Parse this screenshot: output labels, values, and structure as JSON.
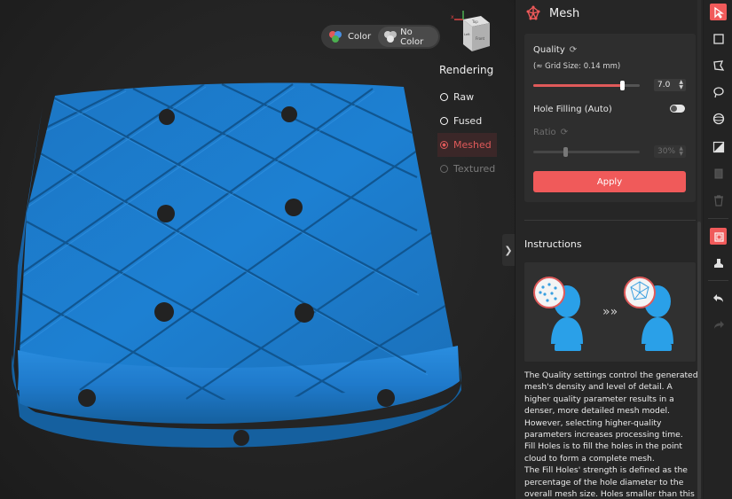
{
  "viewport": {
    "color_toggle": {
      "color_label": "Color",
      "nocolor_label": "No Color"
    },
    "view_cube": {
      "top_face_label": "Top",
      "front_face_label": "Front",
      "side_face_label": "Left"
    },
    "rendering": {
      "title": "Rendering",
      "options": [
        {
          "label": "Raw",
          "state": "normal"
        },
        {
          "label": "Fused",
          "state": "normal"
        },
        {
          "label": "Meshed",
          "state": "active"
        },
        {
          "label": "Textured",
          "state": "disabled"
        }
      ]
    }
  },
  "panel": {
    "title": "Mesh",
    "quality": {
      "label": "Quality",
      "grid_size": "(≈ Grid Size: 0.14 mm)",
      "value": "7.0",
      "slider_fraction": 0.83
    },
    "hole_filling": {
      "label": "Hole Filling (Auto)",
      "enabled": false
    },
    "ratio": {
      "label": "Ratio",
      "value": "30%",
      "slider_fraction": 0.3
    },
    "apply_label": "Apply",
    "instructions": {
      "title": "Instructions",
      "paragraphs": [
        "The Quality settings control the generated mesh's density and level of detail. A higher quality parameter results in a denser, more detailed mesh model. However, selecting higher-quality parameters increases processing time.",
        "Fill Holes is to fill the holes in the point cloud to form a complete mesh.",
        "The Fill Holes' strength is defined as the percentage of the hole diameter to the overall mesh size. Holes smaller than this"
      ]
    }
  },
  "colors": {
    "accent": "#f05a5a",
    "model_blue": "#1f7fcf",
    "panel_bg": "#262626"
  },
  "toolbar": {
    "tools": [
      "select-icon",
      "rectangle-select-icon",
      "polygon-select-icon",
      "lasso-select-icon",
      "sphere-select-icon",
      "invert-selection-icon",
      "eraser-icon",
      "trash-icon",
      "crop-icon",
      "stamp-icon",
      "undo-icon",
      "redo-icon"
    ]
  }
}
